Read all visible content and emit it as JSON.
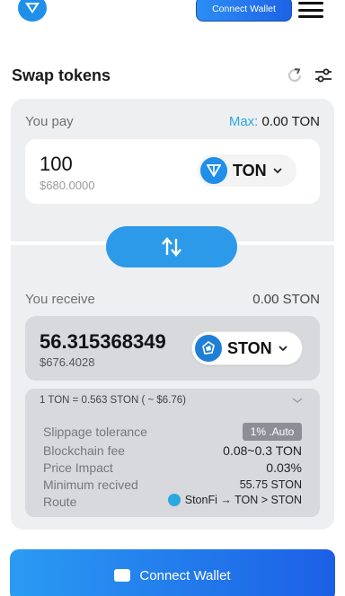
{
  "header": {
    "logo_icon": "app-logo-icon",
    "connect_label": "Connect Wallet",
    "menu_icon": "hamburger-menu-icon"
  },
  "swap": {
    "title": "Swap tokens",
    "refresh_icon": "refresh-icon",
    "settings_icon": "sliders-settings-icon"
  },
  "pay": {
    "label": "You pay",
    "max_label": "Max:",
    "max_value": "0.00 TON",
    "amount": "100",
    "usd": "$680.0000",
    "token": "TON",
    "token_color": "#1f8fea"
  },
  "swap_direction_icon": "swap-arrows-icon",
  "receive": {
    "label": "You receive",
    "balance": "0.00 STON",
    "amount": "56.315368349",
    "usd": "$676.4028",
    "token": "STON",
    "token_color": "#1f7fd6"
  },
  "details": {
    "rate": "1 TON = 0.563 STON  ( ~ $6.76)",
    "slippage_label": "Slippage tolerance",
    "slippage_value": "1% .Auto",
    "fee_label": "Blockchain fee",
    "fee_value": "0.08~0.3 TON",
    "impact_label": "Price Impact",
    "impact_value": "0.03%",
    "min_label": "Minimum recived",
    "min_value": "55.75 STON",
    "route_label": "Route",
    "route_value": "StonFi → TON > STON"
  },
  "footer": {
    "connect_label": "Connect Wallet",
    "wallet_icon": "wallet-icon"
  },
  "colors": {
    "accent": "#2c9ae8",
    "max_accent": "#2aa8e0"
  }
}
